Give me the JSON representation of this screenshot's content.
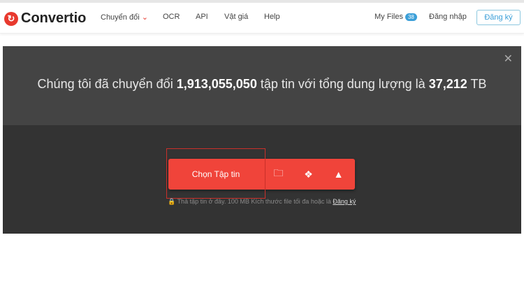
{
  "header": {
    "logo": "Convertio",
    "nav": [
      "Chuyển đổi",
      "OCR",
      "API",
      "Vật giá",
      "Help"
    ],
    "my_files": "My Files",
    "my_files_count": "38",
    "login": "Đăng nhập",
    "signup": "Đăng ký"
  },
  "hero": {
    "stat_prefix": "Chúng tôi đã chuyển đổi",
    "files": "1,913,055,050",
    "stat_mid": "tập tin với tổng dung lượng là",
    "size": "37,212",
    "stat_unit": "TB",
    "choose": "Chọn Tập tin",
    "hint": "Thả tập tin ở đây. 100 MB Kích thước file tối đa hoặc là",
    "hint_link": "Đăng ký"
  }
}
